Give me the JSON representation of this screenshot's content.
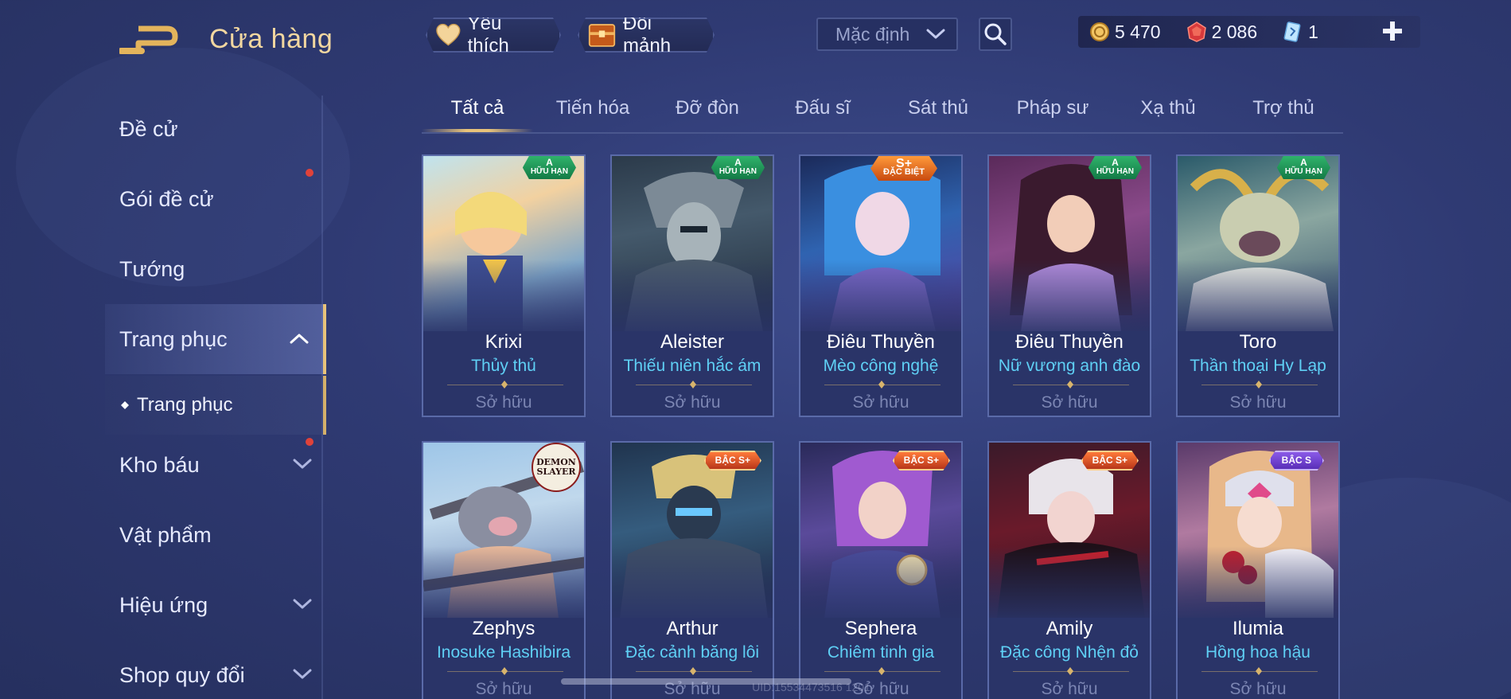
{
  "header": {
    "title": "Cửa hàng",
    "favorite_label": "Yêu thích",
    "exchange_label": "Đổi mảnh",
    "sort_value": "Mặc định"
  },
  "currency": {
    "gold": "5 470",
    "vouchers": "2 086",
    "tickets": "1"
  },
  "sidebar": {
    "items": [
      {
        "label": "Đề cử"
      },
      {
        "label": "Gói đề cử"
      },
      {
        "label": "Tướng"
      },
      {
        "label": "Trang phục"
      },
      {
        "label": "Kho báu"
      },
      {
        "label": "Vật phẩm"
      },
      {
        "label": "Hiệu ứng"
      },
      {
        "label": "Shop quy đổi"
      }
    ],
    "sub_item": "Trang phục"
  },
  "tabs": [
    {
      "label": "Tất cả"
    },
    {
      "label": "Tiến hóa"
    },
    {
      "label": "Đỡ đòn"
    },
    {
      "label": "Đấu sĩ"
    },
    {
      "label": "Sát thủ"
    },
    {
      "label": "Pháp sư"
    },
    {
      "label": "Xạ thủ"
    },
    {
      "label": "Trợ thủ"
    }
  ],
  "cards": [
    {
      "hero": "Krixi",
      "skin": "Thủy thủ",
      "status": "Sở hữu",
      "badge_grade": "A",
      "badge_text": "HỮU HẠN"
    },
    {
      "hero": "Aleister",
      "skin": "Thiếu niên hắc ám",
      "status": "Sở hữu",
      "badge_grade": "A",
      "badge_text": "HỮU HẠN"
    },
    {
      "hero": "Điêu Thuyền",
      "skin": "Mèo công nghệ",
      "status": "Sở hữu",
      "badge_grade": "S+",
      "badge_text": "ĐẶC BIỆT"
    },
    {
      "hero": "Điêu Thuyền",
      "skin": "Nữ vương anh đào",
      "status": "Sở hữu",
      "badge_grade": "A",
      "badge_text": "HỮU HẠN"
    },
    {
      "hero": "Toro",
      "skin": "Thần thoại Hy Lạp",
      "status": "Sở hữu",
      "badge_grade": "A",
      "badge_text": "HỮU HẠN"
    },
    {
      "hero": "Zephys",
      "skin": "Inosuke Hashibira",
      "status": "Sở hữu",
      "collab_top": "DEMON",
      "collab_bottom": "SLAYER"
    },
    {
      "hero": "Arthur",
      "skin": "Đặc cảnh băng lôi",
      "status": "Sở hữu",
      "badge_text": "BẬC S+"
    },
    {
      "hero": "Sephera",
      "skin": "Chiêm tinh gia",
      "status": "Sở hữu",
      "badge_text": "BẬC S+"
    },
    {
      "hero": "Amily",
      "skin": "Đặc công Nhện đỏ",
      "status": "Sở hữu",
      "badge_text": "BẬC S+"
    },
    {
      "hero": "Ilumia",
      "skin": "Hồng hoa hậu",
      "status": "Sở hữu",
      "badge_text": "BẬC S"
    }
  ],
  "footer": {
    "uid": "UID:15534473516 1201"
  },
  "colors": {
    "accent_gold": "#e8c37a",
    "skin_name": "#5fd0f5",
    "owned_text": "#7c86b3",
    "notification": "#e0423a"
  }
}
